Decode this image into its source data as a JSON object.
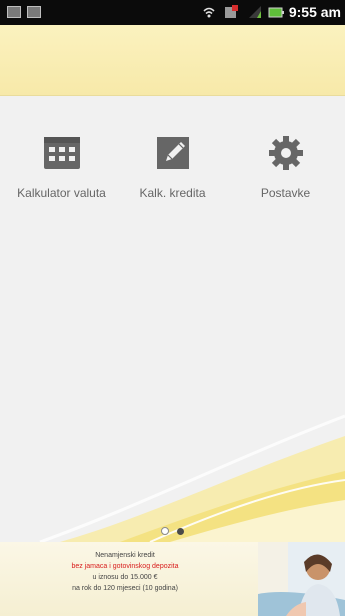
{
  "status_bar": {
    "time": "9:55 am",
    "left_icons": [
      "image-icon",
      "checkbox-icon"
    ],
    "right_icons": [
      "wifi-icon",
      "notification-icon",
      "signal-icon",
      "battery-icon"
    ]
  },
  "launcher": {
    "items": [
      {
        "label": "Kalkulator valuta",
        "icon": "calculator-icon"
      },
      {
        "label": "Kalk. kredita",
        "icon": "pencil-note-icon"
      },
      {
        "label": "Postavke",
        "icon": "gear-icon"
      }
    ]
  },
  "pager": {
    "pages": 2,
    "current": 2
  },
  "ad": {
    "title": "Nenamjenski kredit",
    "highlight": "bez jamaca i gotovinskog depozita",
    "line1": "u iznosu do 15.000 €",
    "line2": "na rok do 120 mjeseci (10 godina)"
  },
  "colors": {
    "status_bar": "#0b0b0b",
    "banner": "#f9eeb5",
    "background": "#f1f1f1",
    "icon": "#666666",
    "ad_highlight": "#d81c1c"
  }
}
